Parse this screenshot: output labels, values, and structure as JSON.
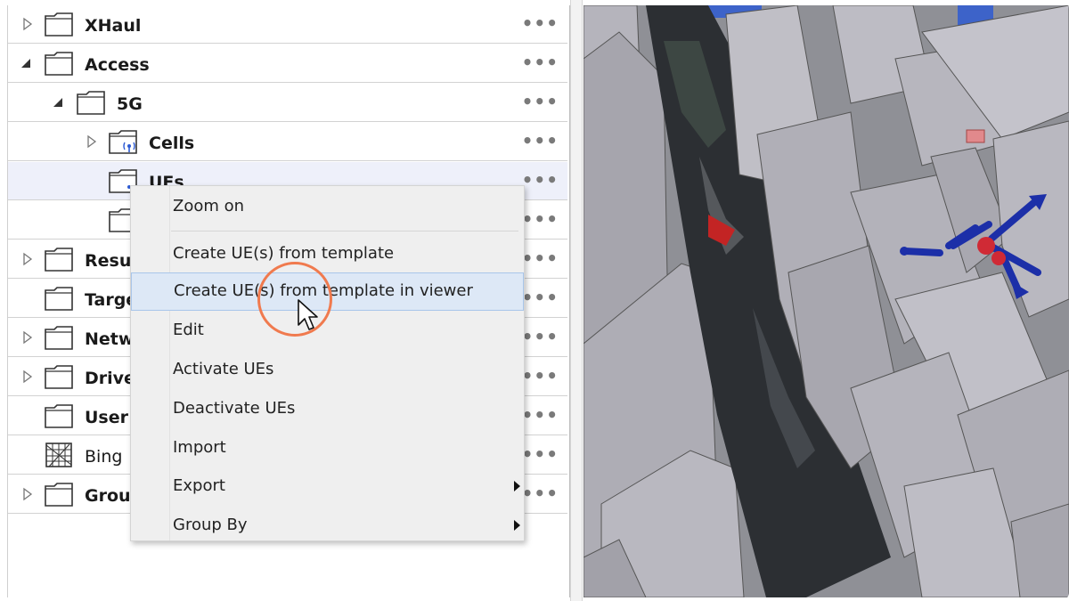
{
  "tree": {
    "rows": [
      {
        "label": "XHaul",
        "expander": "collapsed"
      },
      {
        "label": "Access",
        "expander": "expanded"
      },
      {
        "label": "5G",
        "expander": "expanded"
      },
      {
        "label": "Cells",
        "expander": "collapsed"
      },
      {
        "label": "UEs",
        "expander": "none"
      },
      {
        "label": "",
        "expander": "none"
      },
      {
        "label": "Resul",
        "expander": "collapsed"
      },
      {
        "label": "Targe",
        "expander": "none"
      },
      {
        "label": "Netw",
        "expander": "collapsed"
      },
      {
        "label": "Drive",
        "expander": "collapsed"
      },
      {
        "label": "User",
        "expander": "none"
      },
      {
        "label": "Bing",
        "expander": "none"
      },
      {
        "label": "Grou",
        "expander": "collapsed"
      }
    ],
    "row_menu_glyph": "•••"
  },
  "context_menu": {
    "items": [
      {
        "label": "Zoom on"
      },
      {
        "label": "Create UE(s) from template"
      },
      {
        "label": "Create UE(s) from template in viewer",
        "hovered": true
      },
      {
        "label": "Edit"
      },
      {
        "label": "Activate UEs"
      },
      {
        "label": "Deactivate UEs"
      },
      {
        "label": "Import"
      },
      {
        "label": "Export",
        "submenu": true
      },
      {
        "label": "Group By",
        "submenu": true
      }
    ]
  },
  "colors": {
    "accent_circle": "#f07a4e",
    "hover_bg": "#dde8f6",
    "hover_border": "#a9c6ea",
    "ue_marker": "#1c2fa8"
  },
  "icons": {
    "folder": "folder-icon",
    "cells": "antenna-folder-icon",
    "bing": "map-grid-icon",
    "expand": "triangle-right-icon",
    "collapse": "triangle-down-icon",
    "more": "more-dots-icon"
  }
}
